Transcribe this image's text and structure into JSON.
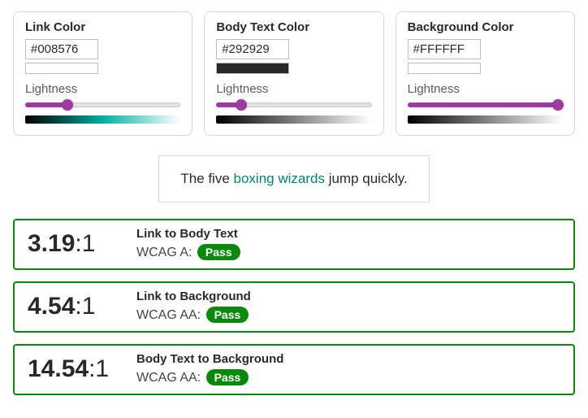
{
  "panels": [
    {
      "title": "Link Color",
      "hex": "#008576",
      "lightness_label": "Lightness",
      "lightness_pct": 27,
      "gradient_mid": "#00b0a0",
      "swatch": "#008576"
    },
    {
      "title": "Body Text Color",
      "hex": "#292929",
      "lightness_label": "Lightness",
      "lightness_pct": 16,
      "gradient_mid": "#808080",
      "swatch": "#292929"
    },
    {
      "title": "Background Color",
      "hex": "#FFFFFF",
      "lightness_label": "Lightness",
      "lightness_pct": 100,
      "gradient_mid": "#808080",
      "swatch": "#FFFFFF"
    }
  ],
  "preview": {
    "before": "The five ",
    "link": "boxing wizards",
    "after": " jump quickly."
  },
  "results": [
    {
      "ratio_bold": "3.19",
      "ratio_tail": ":1",
      "title": "Link to Body Text",
      "wcag_label": "WCAG A: ",
      "badge": "Pass"
    },
    {
      "ratio_bold": "4.54",
      "ratio_tail": ":1",
      "title": "Link to Background",
      "wcag_label": "WCAG AA: ",
      "badge": "Pass"
    },
    {
      "ratio_bold": "14.54",
      "ratio_tail": ":1",
      "title": "Body Text to Background",
      "wcag_label": "WCAG AA: ",
      "badge": "Pass"
    }
  ],
  "colors": {
    "accent": "#9e3aa1",
    "pass": "#0a8a0a",
    "link": "#008576",
    "body": "#292929",
    "bg": "#ffffff"
  }
}
